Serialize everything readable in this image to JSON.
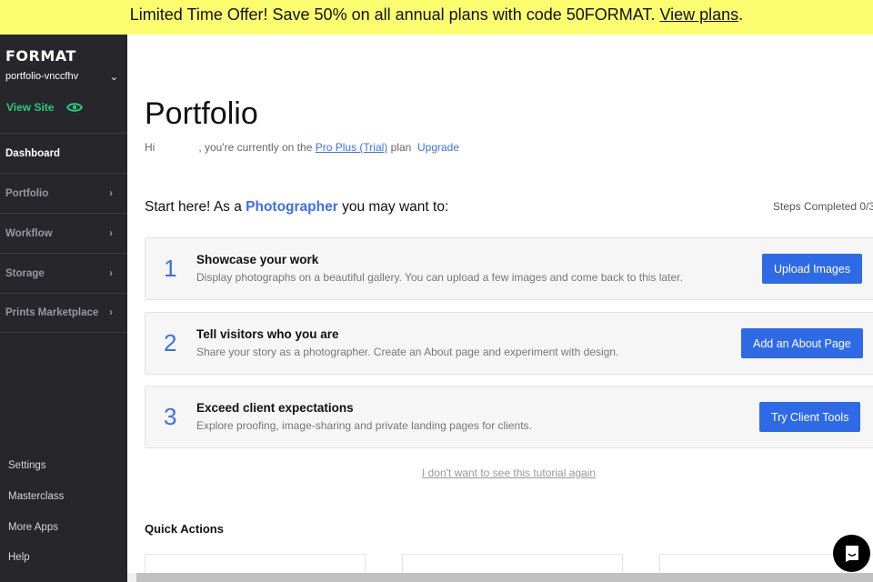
{
  "banner": {
    "text": "Limited Time Offer! Save 50% on all annual plans with code 50FORMAT.",
    "link": "View plans",
    "end": "."
  },
  "sidebar": {
    "logo": "FORMAT",
    "account": "portfolio-vnccfhv",
    "view_site": "View Site",
    "items": [
      {
        "label": "Dashboard"
      },
      {
        "label": "Portfolio"
      },
      {
        "label": "Workflow"
      },
      {
        "label": "Storage"
      },
      {
        "label": "Prints Marketplace"
      }
    ],
    "bottom": [
      "Settings",
      "Masterclass",
      "More Apps",
      "Help"
    ]
  },
  "main": {
    "title": "Portfolio",
    "greet_hi": "Hi",
    "greet_mid": ", you're currently on the",
    "plan": "Pro Plus (Trial)",
    "greet_end": "plan",
    "upgrade": "Upgrade",
    "start_pre": "Start here! As a",
    "role": "Photographer",
    "start_post": "you may want to:",
    "steps": "Steps Completed 0/3",
    "cards": [
      {
        "num": "1",
        "title": "Showcase your work",
        "desc": "Display photographs on a beautiful gallery. You can upload a few images and come back to this later.",
        "button": "Upload Images"
      },
      {
        "num": "2",
        "title": "Tell visitors who you are",
        "desc": "Share your story as a photographer. Create an About page and experiment with design.",
        "button": "Add an About Page"
      },
      {
        "num": "3",
        "title": "Exceed client expectations",
        "desc": "Explore proofing, image-sharing and private landing pages for clients.",
        "button": "Try Client Tools"
      }
    ],
    "skip": "I don't want to see this tutorial again",
    "quick_actions": "Quick Actions"
  }
}
